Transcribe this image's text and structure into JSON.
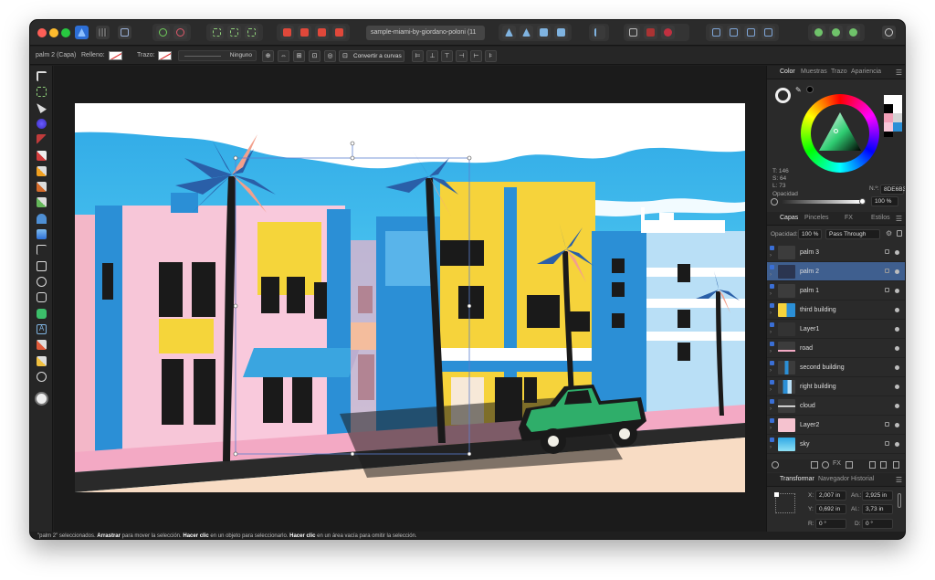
{
  "toolbar": {
    "document_tab": "sample-miami-by-giordano-poloni (11"
  },
  "context_bar": {
    "selection_label": "palm 2 (Capa)",
    "fill_label": "Relleno:",
    "stroke_label": "Trazo:",
    "stroke_style": "Ninguno",
    "convert_label": "Convertir a curvas"
  },
  "color_panel": {
    "tabs": [
      "Color",
      "Muestras",
      "Trazo",
      "Apariencia"
    ],
    "hue": "T: 146",
    "saturation": "S: 64",
    "lightness": "L: 73",
    "hex_label": "N.º:",
    "hex_value": "8DE6B3",
    "opacity_label": "Opacidad",
    "opacity_value": "100 %"
  },
  "layers_panel": {
    "tabs": [
      "Capas",
      "Pinceles",
      "FX",
      "Estilos"
    ],
    "opacity_label": "Opacidad:",
    "opacity_value": "100 %",
    "blend_mode": "Pass Through",
    "layers": [
      {
        "name": "palm 3"
      },
      {
        "name": "palm 2"
      },
      {
        "name": "palm 1"
      },
      {
        "name": "third building"
      },
      {
        "name": "Layer1"
      },
      {
        "name": "road"
      },
      {
        "name": "second building"
      },
      {
        "name": "right building"
      },
      {
        "name": "cloud"
      },
      {
        "name": "Layer2"
      },
      {
        "name": "sky"
      }
    ]
  },
  "transform_panel": {
    "tabs": [
      "Transformar",
      "Navegador",
      "Historial"
    ],
    "x_label": "X:",
    "x_value": "2,007 in",
    "y_label": "Y:",
    "y_value": "0,692 in",
    "w_label": "An.:",
    "w_value": "2,925 in",
    "h_label": "Al.:",
    "h_value": "3,73 in",
    "r_label": "R:",
    "r_value": "0 °",
    "s_label": "D:",
    "s_value": "0 °"
  },
  "status_bar": {
    "part1": "\"palm 2\" seleccionados. ",
    "drag": "Arrastrar",
    "part2": " para mover la selección. ",
    "click": "Hacer clic",
    "part3": " en un objeto para seleccionarlo. ",
    "click2": "Hacer clic",
    "part4": " en un área vacía para omitir la selección."
  }
}
